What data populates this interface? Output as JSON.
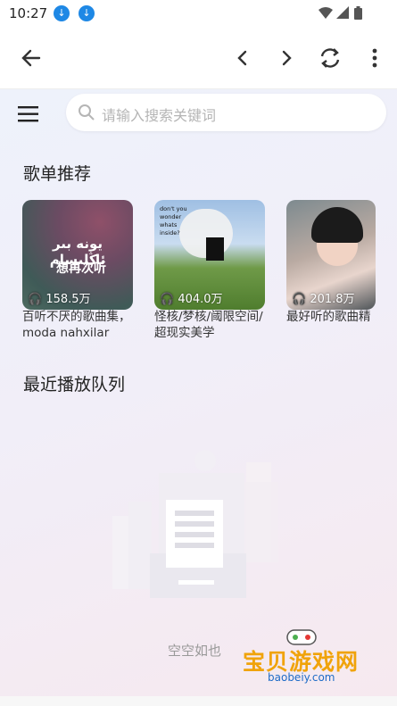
{
  "status_bar": {
    "time": "10:27",
    "icons": [
      "download-icon",
      "download-icon",
      "wifi-icon",
      "signal-icon",
      "battery-icon"
    ]
  },
  "toolbar": {
    "icons": [
      "back-arrow-icon",
      "chevron-left-icon",
      "chevron-right-icon",
      "refresh-icon",
      "more-vert-icon"
    ]
  },
  "search": {
    "placeholder": "请输入搜索关键词"
  },
  "sections": {
    "recommended_title": "歌单推荐",
    "recent_title": "最近播放队列"
  },
  "playlists": [
    {
      "play_count": "158.5万",
      "name": "百听不厌的歌曲集，moda nahxilar",
      "cover_text": "يونە بىر ئاڭلىسام",
      "cover_subtext": "想再次听"
    },
    {
      "play_count": "404.0万",
      "name": "怪核/梦核/阈限空间/超现实美学",
      "cover_text": "don't you wonder whats inside?"
    },
    {
      "play_count": "201.8万",
      "name": "最好听的歌曲精"
    }
  ],
  "empty_state": {
    "text": "空空如也"
  },
  "watermark": {
    "text": "宝贝游戏网",
    "url": "baobeiy.com"
  },
  "colors": {
    "accent_blue": "#1e88e5",
    "watermark_orange": "#f0a30a"
  }
}
